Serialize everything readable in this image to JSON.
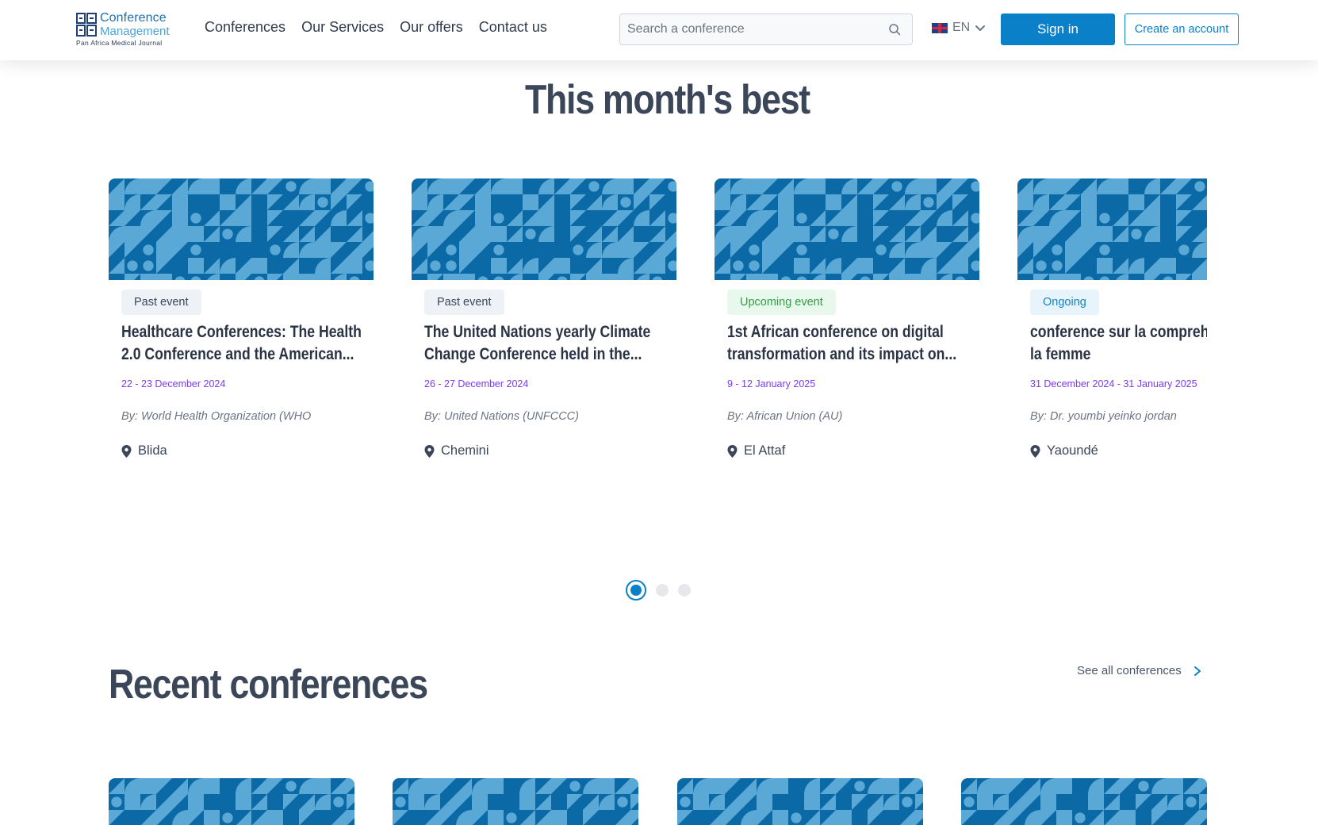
{
  "header": {
    "logo": {
      "line1": "Conference",
      "line2": "Management",
      "line3": "Pan Africa Medical Journal"
    },
    "nav": [
      "Conferences",
      "Our Services",
      "Our offers",
      "Contact us"
    ],
    "search": {
      "placeholder": "Search a conference",
      "icon": "search-icon"
    },
    "language": {
      "code": "EN",
      "flag": "uk-flag-icon"
    },
    "sign_in": "Sign in",
    "create_account": "Create an account"
  },
  "best": {
    "title": "This month's best",
    "cards": [
      {
        "status": "Past event",
        "status_type": "past",
        "title_line1": "Healthcare Conferences: The Health",
        "title_line2": "2.0 Conference and the American...",
        "date": "22 - 23 December 2024",
        "by": "By: World Health Organization (WHO",
        "location": "Blida"
      },
      {
        "status": "Past event",
        "status_type": "past",
        "title_line1": "The United Nations yearly Climate",
        "title_line2": "Change Conference held in the...",
        "date": "26 - 27 December 2024",
        "by": "By: United Nations (UNFCCC)",
        "location": "Chemini"
      },
      {
        "status": "Upcoming event",
        "status_type": "upcoming",
        "title_line1": "1st African conference on digital",
        "title_line2": "transformation and its impact on...",
        "date": "9 - 12 January 2025",
        "by": "By: African Union (AU)",
        "location": "El Attaf"
      },
      {
        "status": "Ongoing",
        "status_type": "ongoing",
        "title_line1": "conference sur la comprehension de",
        "title_line2": "la femme",
        "date": "31 December 2024 - 31 January 2025",
        "by": "By: Dr. youmbi yeinko jordan",
        "location": "Yaoundé"
      }
    ],
    "pagination": {
      "pages": 3,
      "active": 1
    }
  },
  "recent": {
    "title": "Recent conferences",
    "see_all": "See all conferences"
  },
  "colors": {
    "primary": "#0a80c8",
    "pattern_dark": "#0b6aa6",
    "pattern_light": "#5aa8d6",
    "date": "#7c3aed"
  }
}
